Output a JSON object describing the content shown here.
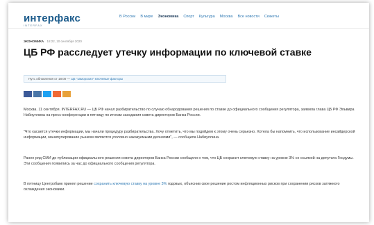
{
  "header": {
    "logo_main": "интерфакс",
    "logo_sub": "INTERFAX",
    "nav": [
      "В России",
      "В мире",
      "Экономика",
      "Спорт",
      "Культура",
      "Москва",
      "Все новости",
      "Сюжеты"
    ],
    "active_nav": "Экономика"
  },
  "article": {
    "section": "ЭКОНОМИКА",
    "date": "18:22, 10 сентября 2020",
    "title": "ЦБ РФ расследует утечку информации по ключевой ставке",
    "infobox_prefix": "Путь обновления от 18:00 —",
    "infobox_link": "ЦБ \"заморозил\" ключевые факторы",
    "share_colors": [
      "#3b5998",
      "#4a76a8",
      "#1da1f2",
      "#f06a35",
      "#e8a13a"
    ],
    "p1": "Москва. 11 сентября. INTERFAX.RU — ЦБ РФ начал разбирательство по случаю обнародования решения по ставке до официального сообщения регулятора, заявила глава ЦБ РФ Эльвира Набиуллина на пресс-конференции в пятницу по итогам заседания совета директоров Банка России.",
    "p2": "\"Что касается утечки информации, мы начали процедуру разбирательства. Хочу отметить, что мы подойдем к этому очень серьезно. Хотела бы напомнить, что использование инсайдерской информации, манипулирование рынком являются уголовно наказуемыми деяниями\", — сообщила Набиуллина.",
    "p3": "Ранее ряд СМИ до публикации официального решения совета директоров Банка России сообщили о том, что ЦБ сохранит ключевую ставку на уровне 3% со ссылкой на депутата Госдумы. Эти сообщения появились за час до официального сообщения регулятора.",
    "p4_start": "В пятницу Центробанк принял решение ",
    "p4_link": "сохранить ключевую ставку на уровне 3%",
    "p4_end": " годовых, объяснив свое решение ростом инфляционных рисков при сохранении рисков затяжного охлаждения экономики."
  }
}
